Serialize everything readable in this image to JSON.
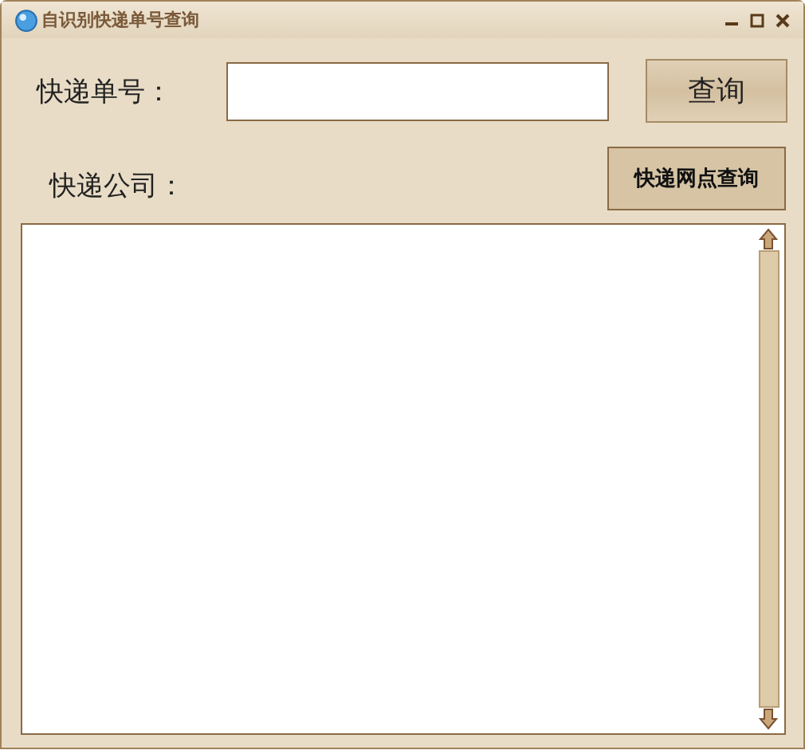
{
  "window": {
    "title": "自识别快递单号查询"
  },
  "tracking_number": {
    "label": "快递单号："
  },
  "query_button": {
    "label": "查询"
  },
  "company": {
    "label": "快递公司："
  },
  "outlet_button": {
    "label": "快递网点查询"
  }
}
